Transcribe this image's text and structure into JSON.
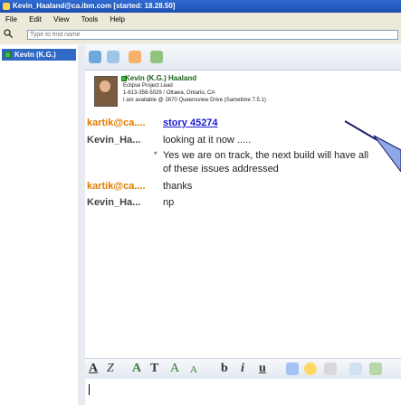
{
  "window": {
    "title": "Kevin_Haaland@ca.ibm.com [started: 18.28.50]"
  },
  "menu": [
    "File",
    "Edit",
    "View",
    "Tools",
    "Help"
  ],
  "search": {
    "placeholder": "Type to find name"
  },
  "contacts": [
    {
      "label": "Kevin (K.G.)",
      "status": "available"
    }
  ],
  "card": {
    "name": "Kevin (K.G.) Haaland",
    "role": "Eclipse Project Lead",
    "phone_location": "1-613-356-5029 / Ottawa, Ontario, CA",
    "availability": "I am available @ 2670 Queensview Drive (Sametime 7.5.1)"
  },
  "messages": [
    {
      "from": "kartik@ca....",
      "text": "story 45274",
      "link": true
    },
    {
      "from": "Kevin_Ha...",
      "text": "looking at it now ....."
    },
    {
      "from": "",
      "text": "Yes we are on track, the next build will have all",
      "bullet": "*"
    },
    {
      "from": "",
      "text": "of these issues addressed"
    },
    {
      "from": "kartik@ca....",
      "text": "thanks"
    },
    {
      "from": "Kevin_Ha...",
      "text": "np"
    }
  ],
  "format_toolbar": [
    "A",
    "Z",
    "A",
    "T",
    "A",
    "A",
    "b",
    "i",
    "u"
  ],
  "icons": {
    "toolbar": [
      "group-chat-icon",
      "meeting-icon",
      "add-person-icon",
      "people-icon"
    ],
    "format": [
      "bold-style-icon",
      "italic-style-icon",
      "text-color-icon",
      "font-icon",
      "grow-font-icon",
      "shrink-font-icon",
      "bold-icon",
      "italic-icon",
      "underline-icon",
      "draw-icon",
      "emoticon-icon",
      "link-icon",
      "attach-icon",
      "screen-icon"
    ]
  },
  "colors": {
    "accent": "#316ac5",
    "from_kartik": "#e07b00",
    "link": "#1a1ad0"
  }
}
